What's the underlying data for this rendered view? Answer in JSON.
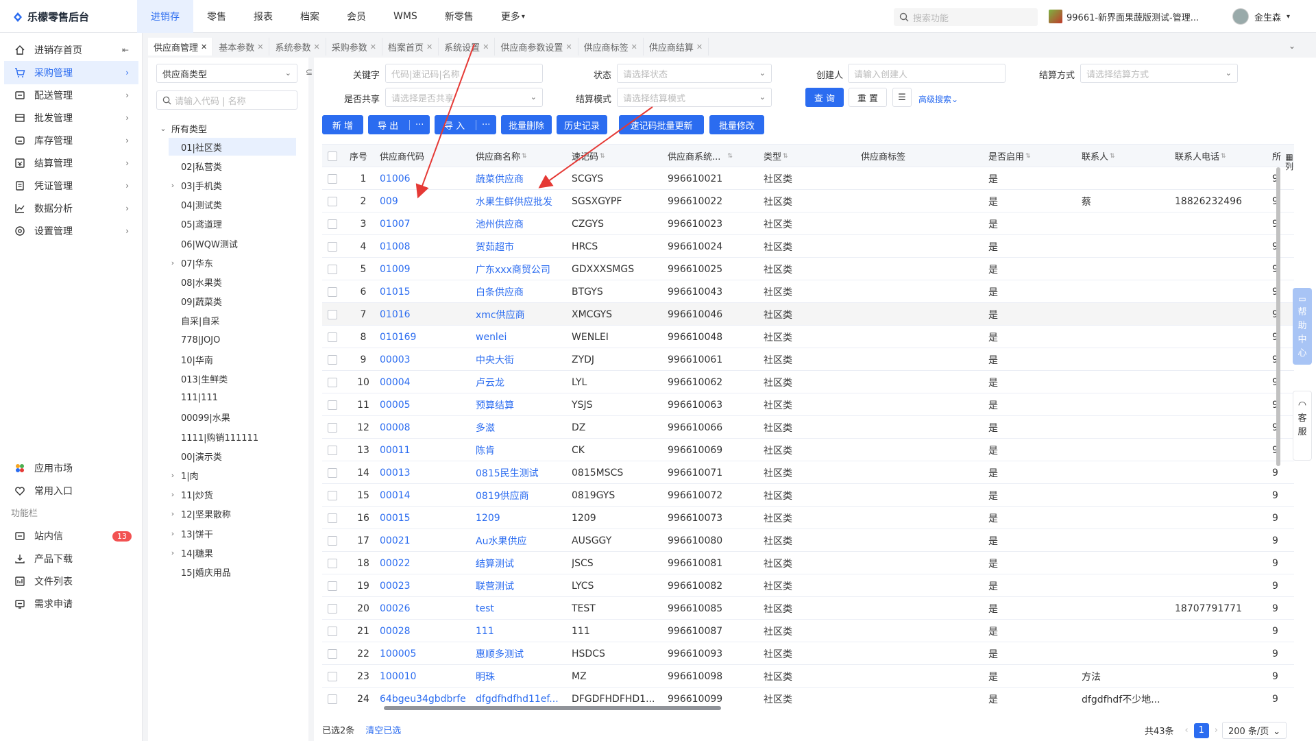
{
  "app": {
    "title": "乐檬零售后台"
  },
  "topnav": [
    "进销存",
    "零售",
    "报表",
    "档案",
    "会员",
    "WMS",
    "新零售",
    "更多"
  ],
  "header": {
    "search_placeholder": "搜索功能",
    "store": "99661-新界面果蔬版测试-管理...",
    "user": "金生森"
  },
  "sidebar": {
    "items": [
      {
        "label": "进销存首页",
        "icon": "home-icon"
      },
      {
        "label": "采购管理",
        "icon": "cart-icon"
      },
      {
        "label": "配送管理",
        "icon": "delivery-icon"
      },
      {
        "label": "批发管理",
        "icon": "wholesale-icon"
      },
      {
        "label": "库存管理",
        "icon": "inventory-icon"
      },
      {
        "label": "结算管理",
        "icon": "settlement-icon"
      },
      {
        "label": "凭证管理",
        "icon": "voucher-icon"
      },
      {
        "label": "数据分析",
        "icon": "chart-icon"
      },
      {
        "label": "设置管理",
        "icon": "settings-icon"
      }
    ],
    "bottom": [
      {
        "label": "应用市场",
        "icon": "app-market-icon"
      },
      {
        "label": "常用入口",
        "icon": "heart-icon"
      }
    ],
    "section_label": "功能栏",
    "func": [
      {
        "label": "站内信",
        "icon": "mail-icon",
        "badge": "13"
      },
      {
        "label": "产品下载",
        "icon": "download-icon"
      },
      {
        "label": "文件列表",
        "icon": "file-list-icon"
      },
      {
        "label": "需求申请",
        "icon": "request-icon"
      }
    ]
  },
  "tabs": [
    "供应商管理",
    "基本参数",
    "系统参数",
    "采购参数",
    "档案首页",
    "系统设置",
    "供应商参数设置",
    "供应商标签",
    "供应商结算"
  ],
  "tree": {
    "type_select": "供应商类型",
    "search_placeholder": "请输入代码 | 名称",
    "root": "所有类型",
    "nodes": [
      {
        "label": "01|社区类",
        "toggle": ""
      },
      {
        "label": "02|私营类",
        "toggle": ""
      },
      {
        "label": "03|手机类",
        "toggle": "›"
      },
      {
        "label": "04|测试类",
        "toggle": ""
      },
      {
        "label": "05|鸢道理",
        "toggle": ""
      },
      {
        "label": "06|WQW测试",
        "toggle": ""
      },
      {
        "label": "07|华东",
        "toggle": "›"
      },
      {
        "label": "08|水果类",
        "toggle": ""
      },
      {
        "label": "09|蔬菜类",
        "toggle": ""
      },
      {
        "label": "自采|自采",
        "toggle": ""
      },
      {
        "label": "778|JOJO",
        "toggle": ""
      },
      {
        "label": "10|华南",
        "toggle": ""
      },
      {
        "label": "013|生鲜类",
        "toggle": ""
      },
      {
        "label": "111|111",
        "toggle": ""
      },
      {
        "label": "00099|水果",
        "toggle": ""
      },
      {
        "label": "1111|购销111111",
        "toggle": ""
      },
      {
        "label": "00|演示类",
        "toggle": ""
      },
      {
        "label": "1|肉",
        "toggle": "›"
      },
      {
        "label": "11|炒货",
        "toggle": "›"
      },
      {
        "label": "12|坚果散称",
        "toggle": "›"
      },
      {
        "label": "13|饼干",
        "toggle": "›"
      },
      {
        "label": "14|糖果",
        "toggle": "›"
      },
      {
        "label": "15|婚庆用品",
        "toggle": ""
      }
    ]
  },
  "filters": {
    "keyword_label": "关键字",
    "keyword_placeholder": "代码|速记码|名称",
    "status_label": "状态",
    "status_placeholder": "请选择状态",
    "creator_label": "创建人",
    "creator_placeholder": "请输入创建人",
    "settle_label": "结算方式",
    "settle_placeholder": "请选择结算方式",
    "share_label": "是否共享",
    "share_placeholder": "请选择是否共享",
    "mode_label": "结算模式",
    "mode_placeholder": "请选择结算模式",
    "query": "查 询",
    "reset": "重 置",
    "advanced": "高级搜索"
  },
  "toolbar": {
    "new": "新 增",
    "export": "导 出",
    "import": "导 入",
    "more": "···",
    "batch_delete": "批量删除",
    "history": "历史记录",
    "batch_update_code": "速记码批量更新",
    "batch_edit": "批量修改"
  },
  "table": {
    "headers": [
      "序号",
      "供应商代码",
      "供应商名称",
      "速记码",
      "供应商系统...",
      "类型",
      "供应商标签",
      "是否启用",
      "联系人",
      "联系人电话",
      "所"
    ],
    "column_setting": "列",
    "rows": [
      [
        "1",
        "01006",
        "蔬菜供应商",
        "SCGYS",
        "996610021",
        "社区类",
        "",
        "是",
        "",
        ""
      ],
      [
        "2",
        "009",
        "水果生鲜供应批发",
        "SGSXGYPF",
        "996610022",
        "社区类",
        "",
        "是",
        "蔡",
        "18826232496"
      ],
      [
        "3",
        "01007",
        "池州供应商",
        "CZGYS",
        "996610023",
        "社区类",
        "",
        "是",
        "",
        ""
      ],
      [
        "4",
        "01008",
        "贺茹超市",
        "HRCS",
        "996610024",
        "社区类",
        "",
        "是",
        "",
        ""
      ],
      [
        "5",
        "01009",
        "广东xxx商贸公司",
        "GDXXXSMGS",
        "996610025",
        "社区类",
        "",
        "是",
        "",
        ""
      ],
      [
        "6",
        "01015",
        "白条供应商",
        "BTGYS",
        "996610043",
        "社区类",
        "",
        "是",
        "",
        ""
      ],
      [
        "7",
        "01016",
        "xmc供应商",
        "XMCGYS",
        "996610046",
        "社区类",
        "",
        "是",
        "",
        ""
      ],
      [
        "8",
        "010169",
        "wenlei",
        "WENLEI",
        "996610048",
        "社区类",
        "",
        "是",
        "",
        ""
      ],
      [
        "9",
        "00003",
        "中央大街",
        "ZYDJ",
        "996610061",
        "社区类",
        "",
        "是",
        "",
        ""
      ],
      [
        "10",
        "00004",
        "卢云龙",
        "LYL",
        "996610062",
        "社区类",
        "",
        "是",
        "",
        ""
      ],
      [
        "11",
        "00005",
        "预算结算",
        "YSJS",
        "996610063",
        "社区类",
        "",
        "是",
        "",
        ""
      ],
      [
        "12",
        "00008",
        "多滋",
        "DZ",
        "996610066",
        "社区类",
        "",
        "是",
        "",
        ""
      ],
      [
        "13",
        "00011",
        "陈肯",
        "CK",
        "996610069",
        "社区类",
        "",
        "是",
        "",
        ""
      ],
      [
        "14",
        "00013",
        "0815民生测试",
        "0815MSCS",
        "996610071",
        "社区类",
        "",
        "是",
        "",
        ""
      ],
      [
        "15",
        "00014",
        "0819供应商",
        "0819GYS",
        "996610072",
        "社区类",
        "",
        "是",
        "",
        ""
      ],
      [
        "16",
        "00015",
        "1209",
        "1209",
        "996610073",
        "社区类",
        "",
        "是",
        "",
        ""
      ],
      [
        "17",
        "00021",
        "Au水果供应",
        "AUSGGY",
        "996610080",
        "社区类",
        "",
        "是",
        "",
        ""
      ],
      [
        "18",
        "00022",
        "结算测试",
        "JSCS",
        "996610081",
        "社区类",
        "",
        "是",
        "",
        ""
      ],
      [
        "19",
        "00023",
        "联营测试",
        "LYCS",
        "996610082",
        "社区类",
        "",
        "是",
        "",
        ""
      ],
      [
        "20",
        "00026",
        "test",
        "TEST",
        "996610085",
        "社区类",
        "",
        "是",
        "",
        "18707791771"
      ],
      [
        "21",
        "00028",
        "111",
        "111",
        "996610087",
        "社区类",
        "",
        "是",
        "",
        ""
      ],
      [
        "22",
        "100005",
        "惠顺多测试",
        "HSDCS",
        "996610093",
        "社区类",
        "",
        "是",
        "",
        ""
      ],
      [
        "23",
        "100010",
        "明珠",
        "MZ",
        "996610098",
        "社区类",
        "",
        "是",
        "方法",
        ""
      ],
      [
        "24",
        "64bgeu34gbdbrfe",
        "dfgdfhdfhd11ef...",
        "DFGDFHDFHD1...",
        "996610099",
        "社区类",
        "",
        "是",
        "dfgdfhdf不少地...",
        ""
      ]
    ]
  },
  "footer": {
    "selected": "已选2条",
    "clear": "清空已选",
    "total": "共43条",
    "page": "1",
    "page_size": "200 条/页"
  },
  "side_widgets": {
    "help": [
      "帮",
      "助",
      "中",
      "心"
    ],
    "service": [
      "客",
      "服"
    ]
  },
  "colors": {
    "primary": "#2b6cf0",
    "active_bg": "#e8f0fe",
    "badge": "#f25252",
    "arrow": "#e53935"
  }
}
